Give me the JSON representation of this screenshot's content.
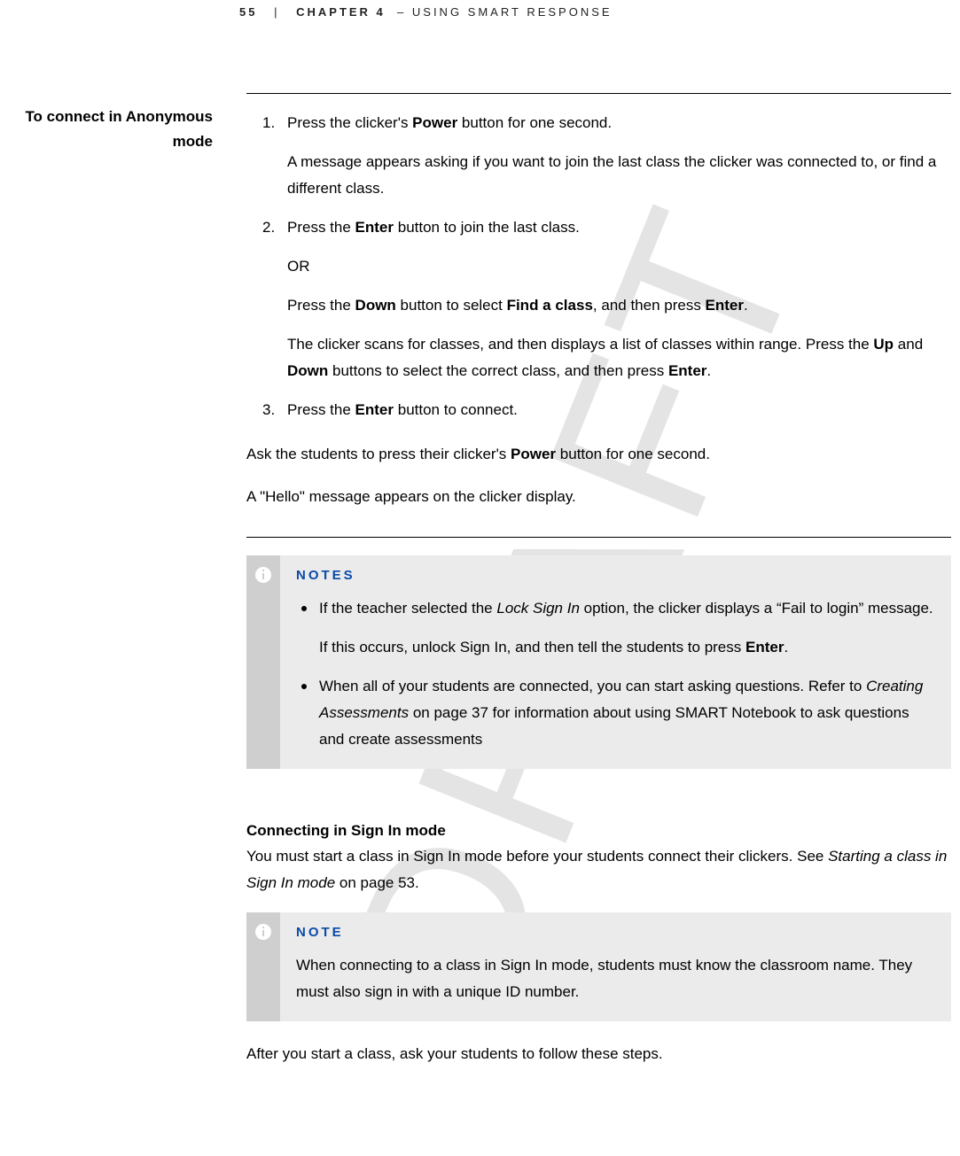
{
  "header": {
    "page_number": "55",
    "separator": "|",
    "chapter_label": "CHAPTER 4",
    "title_suffix": "– USING SMART RESPONSE"
  },
  "watermark": "DRAFT",
  "sidebar": {
    "heading_l1": "To connect in Anonymous",
    "heading_l2": "mode"
  },
  "steps": [
    {
      "num": "1.",
      "p1_a": "Press the clicker's ",
      "p1_b_bold": "Power",
      "p1_c": " button for one second.",
      "p2": "A message appears asking if you want to join the last class the clicker was connected to, or find a different class."
    },
    {
      "num": "2.",
      "p1_a": "Press the ",
      "p1_b_bold": "Enter",
      "p1_c": " button to join the last class.",
      "p2": "OR",
      "p3_a": "Press the ",
      "p3_b_bold": "Down",
      "p3_c": " button to select ",
      "p3_d_bold": "Find a class",
      "p3_e": ", and then press ",
      "p3_f_bold": "Enter",
      "p3_g": ".",
      "p4_a": "The clicker scans for classes, and then displays a list of classes within range. Press the ",
      "p4_b_bold": "Up",
      "p4_c": " and ",
      "p4_d_bold": "Down",
      "p4_e": " buttons to select the correct class, and then press ",
      "p4_f_bold": "Enter",
      "p4_g": "."
    },
    {
      "num": "3.",
      "p1_a": "Press the ",
      "p1_b_bold": "Enter",
      "p1_c": " button to connect."
    }
  ],
  "after_steps": {
    "p1_a": "Ask the students to press their clicker's ",
    "p1_b_bold": "Power",
    "p1_c": " button for one second.",
    "p2": "A \"Hello\" message appears on the clicker display."
  },
  "notes_box": {
    "title": "NOTES",
    "items": [
      {
        "p1_a": "If the teacher selected the ",
        "p1_b_italic": "Lock Sign In",
        "p1_c": " option, the clicker displays a “Fail to login” message.",
        "p2_a": "If this occurs, unlock Sign In, and then tell the students to press ",
        "p2_b_bold": "Enter",
        "p2_c": "."
      },
      {
        "p1_a": "When all of your students are connected, you can start asking questions. Refer to ",
        "p1_b_italic": "Creating Assessments",
        "p1_c": " on page 37 for information about using SMART Notebook to ask questions and create assessments"
      }
    ]
  },
  "section2": {
    "heading": "Connecting in Sign In mode",
    "p1_a": "You must start a class in Sign In mode before your students connect their clickers. See ",
    "p1_b_italic": "Starting a class in Sign In mode",
    "p1_c": " on page 53."
  },
  "note_box": {
    "title": "NOTE",
    "p1": "When connecting to a class in Sign In mode, students must know the classroom name. They must also sign in with a unique ID number."
  },
  "closing": "After you start a class, ask your students to follow these steps."
}
